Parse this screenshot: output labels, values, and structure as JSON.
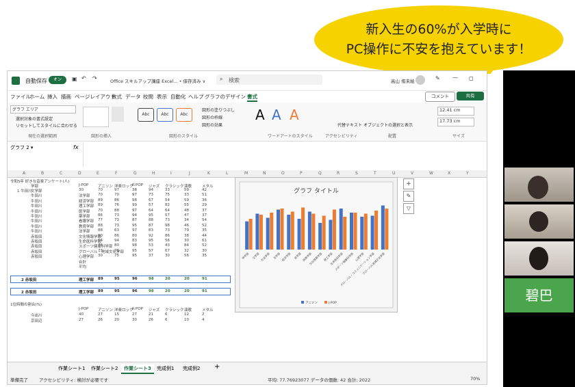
{
  "bubble": {
    "line1": "新入生の60%が入学時に",
    "line2": "PC操作に不安を抱えています！"
  },
  "excel": {
    "autosave_label": "自動保存",
    "autosave_state": "オン",
    "doc_title": "Office スキルアップ講座 Excel... • 保存済み ∨",
    "search_placeholder": "検索",
    "user_name": "高山 侑未絵",
    "menu": [
      "ファイル",
      "ホーム",
      "挿入",
      "描画",
      "ページレイアウト",
      "数式",
      "データ",
      "校閲",
      "表示",
      "自動化",
      "ヘルプ",
      "グラフのデザイン",
      "書式"
    ],
    "comment_button": "コメント",
    "share_button": "共有",
    "ribbon": {
      "groups": [
        "現在の選択範囲",
        "図形の挿入",
        "図形のスタイル",
        "ワードアートのスタイル",
        "アクセシビリティ",
        "配置",
        "サイズ"
      ],
      "chart_area_select": "グラフ エリア",
      "format_selection": "選択対象の書式設定",
      "reset_style": "リセットしてスタイルに合わせる",
      "shape_fill": "図形の塗りつぶし",
      "shape_outline": "図形の枠線",
      "shape_effects": "図形の効果",
      "alt_text": "代替テキスト",
      "selection_pane": "オブジェクトの選択と表示",
      "height": "12.41 cm",
      "width": "17.73 cm",
      "style_sample": "Abc",
      "wordart_sample": "A"
    },
    "name_box": "グラフ 2",
    "fx_label": "fx",
    "columns": [
      "A",
      "B",
      "C",
      "D",
      "E",
      "F",
      "G",
      "H",
      "I",
      "J",
      "K",
      "L",
      "M",
      "N",
      "O",
      "P",
      "Q",
      "R",
      "S",
      "T",
      "U",
      "V",
      "W",
      "X",
      "Y"
    ],
    "sheet": {
      "title": "令和5年 好きな音楽アンケート(人)",
      "headers": [
        "学部",
        "J-POP",
        "アニソン",
        "洋楽ロック",
        "K-POP",
        "ジャズ",
        "クラシック",
        "演歌",
        "メタル"
      ],
      "rows": [
        [
          "1 牛田川",
          "文学部",
          "30",
          "70",
          "97",
          "38",
          "94",
          "33",
          "59",
          "42"
        ],
        [
          "",
          "牛田川",
          "法学部",
          "70",
          "70",
          "97",
          "73",
          "75",
          "33",
          "51"
        ],
        [
          "",
          "牛田川",
          "経済学部",
          "89",
          "86",
          "98",
          "67",
          "54",
          "59",
          "36"
        ],
        [
          "",
          "牛田川",
          "理工学部",
          "89",
          "76",
          "99",
          "57",
          "82",
          "55",
          "29"
        ],
        [
          "",
          "牛田川",
          "医学部",
          "70",
          "88",
          "97",
          "64",
          "64",
          "48",
          "37"
        ],
        [
          "",
          "牛田川",
          "薬学部",
          "86",
          "73",
          "94",
          "95",
          "57",
          "47",
          "37"
        ],
        [
          "",
          "牛田川",
          "看護学部",
          "77",
          "73",
          "87",
          "88",
          "73",
          "34",
          "54"
        ],
        [
          "",
          "牛田川",
          "教育学部",
          "88",
          "73",
          "95",
          "87",
          "98",
          "46",
          "52"
        ],
        [
          "",
          "牛田川",
          "法学部",
          "88",
          "63",
          "97",
          "83",
          "73",
          "79",
          "35"
        ],
        [
          "",
          "赤坂田",
          "文化情報学部",
          "90",
          "86",
          "80",
          "92",
          "86",
          "38",
          "44"
        ],
        [
          "",
          "赤坂田",
          "生命医科学部",
          "64",
          "94",
          "83",
          "95",
          "56",
          "30",
          "61"
        ],
        [
          "",
          "赤坂田",
          "スポーツ健康科学部",
          "76",
          "80",
          "98",
          "53",
          "43",
          "84",
          "52"
        ],
        [
          "",
          "赤坂田",
          "グローバル・地域文化学部",
          "73",
          "76",
          "95",
          "57",
          "67",
          "32",
          "30"
        ],
        [
          "",
          "赤坂田",
          "心理学部",
          "30",
          "75",
          "95",
          "37",
          "30",
          "56",
          "35"
        ]
      ],
      "total_label": "合計",
      "average_label": "平均",
      "highlight_rows": [
        [
          "2 赤坂田",
          "理工学部",
          "89",
          "95",
          "96",
          "98",
          "20",
          "20",
          "91"
        ],
        [
          "2 赤坂田",
          "理工学部",
          "89",
          "95",
          "96",
          "98",
          "20",
          "20",
          "91"
        ]
      ],
      "section2_title": "1位時間の割合(%)",
      "section2_headers": [
        "J-POP",
        "アニソン",
        "洋楽ロック",
        "K-POP",
        "ジャズ",
        "クラシック",
        "演歌",
        "メタル"
      ],
      "section2_rows": [
        [
          "今出川",
          "40",
          "27",
          "15",
          "27",
          "21",
          "6",
          "12",
          "2"
        ],
        [
          "京田辺",
          "27",
          "26",
          "20",
          "30",
          "26",
          "6",
          "10",
          "4"
        ]
      ]
    },
    "tabs": [
      "作業シート1",
      "作業シート2",
      "作業シート3",
      "完成例1",
      "完成例2"
    ],
    "active_tab": "作業シート3",
    "status_left": "準備完了",
    "status_access": "アクセシビリティ: 検討が必要です",
    "status_stats": "平均: 77.76923077   データの個数: 42   合計: 2022",
    "zoom": "70%"
  },
  "chart_data": {
    "type": "bar",
    "title": "グラフ タイトル",
    "categories": [
      "神学部",
      "文学部",
      "社会学部",
      "法学部",
      "経済学部",
      "商学部",
      "政策学部",
      "文化情報学部",
      "理工学部",
      "生命医科学部",
      "スポーツ健康科学部",
      "心理学部",
      "グローバル・コミュニケーション学部",
      "グローバル地域文化学部"
    ],
    "series": [
      {
        "name": "アニソン",
        "color": "#4472c4",
        "values": [
          55,
          70,
          62,
          78,
          68,
          60,
          74,
          52,
          58,
          80,
          72,
          64,
          66,
          86
        ]
      },
      {
        "name": "J-POP",
        "color": "#ed7d31",
        "values": [
          60,
          68,
          72,
          80,
          74,
          82,
          70,
          66,
          78,
          64,
          72,
          70,
          76,
          80
        ]
      }
    ],
    "ylim": [
      0,
      100
    ]
  },
  "participants": {
    "name_tile": "碧巴"
  }
}
